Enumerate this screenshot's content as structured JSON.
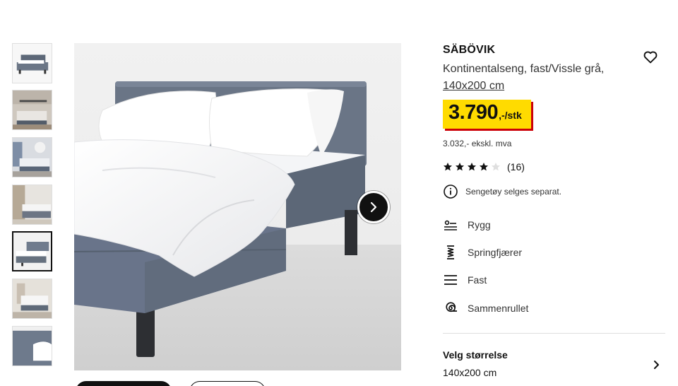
{
  "product": {
    "name": "SÄBÖVIK",
    "description": "Kontinentalseng, fast/Vissle grå,",
    "size_link": "140x200 cm",
    "price_main": "3.790",
    "price_unit": ",-/stk",
    "price_ex_vat": "3.032,- ekskl. mva",
    "rating_value": 4,
    "rating_max": 5,
    "rating_count": "(16)",
    "notice": "Sengetøy selges separat."
  },
  "features": [
    {
      "label": "Rygg",
      "icon": "back-sleeper-icon"
    },
    {
      "label": "Springfjærer",
      "icon": "spring-icon"
    },
    {
      "label": "Fast",
      "icon": "firmness-lines-icon"
    },
    {
      "label": "Sammenrullet",
      "icon": "rolled-icon"
    }
  ],
  "size_selector": {
    "title": "Velg størrelse",
    "value": "140x200 cm"
  },
  "gallery": {
    "thumbnail_count": 7,
    "selected_index": 4
  },
  "colors": {
    "price_bg": "#ffdb00",
    "price_shadow": "#cc0008",
    "text": "#111111"
  }
}
